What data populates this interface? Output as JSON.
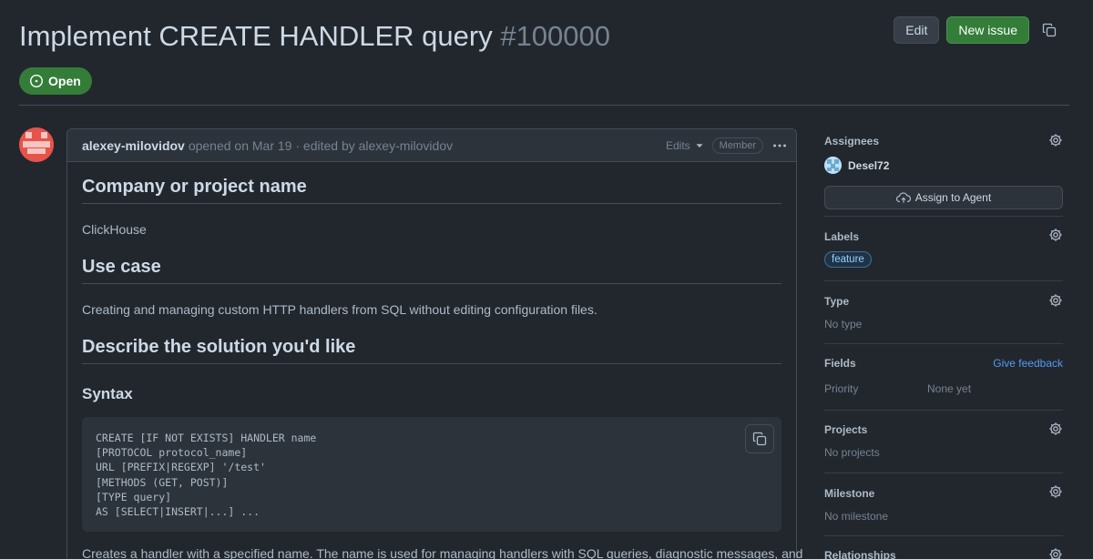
{
  "issue": {
    "title": "Implement CREATE HANDLER query",
    "number": "#100000",
    "state": "Open"
  },
  "header_actions": {
    "edit_label": "Edit",
    "new_issue_label": "New issue"
  },
  "comment": {
    "author": "alexey-milovidov",
    "meta": "opened on Mar 19 · edited by alexey-milovidov",
    "edits_label": "Edits",
    "role_badge": "Member",
    "sections": {
      "h_company": "Company or project name",
      "company": "ClickHouse",
      "h_usecase": "Use case",
      "usecase": "Creating and managing custom HTTP handlers from SQL without editing configuration files.",
      "h_solution": "Describe the solution you'd like",
      "h_syntax": "Syntax",
      "tail": "Creates a handler with a specified name. The name is used for managing handlers with SQL queries, diagnostic messages, and"
    },
    "code_lines": [
      "CREATE [IF NOT EXISTS] HANDLER name",
      "[PROTOCOL protocol_name]",
      "URL [PREFIX|REGEXP] '/test'",
      "[METHODS (GET, POST)]",
      "[TYPE query]",
      "AS [SELECT|INSERT|...] ..."
    ]
  },
  "sidebar": {
    "assignees": {
      "title": "Assignees",
      "user": "Desel72",
      "agent_button": "Assign to Agent"
    },
    "labels": {
      "title": "Labels",
      "items": [
        "feature"
      ]
    },
    "type": {
      "title": "Type",
      "value": "No type"
    },
    "fields": {
      "title": "Fields",
      "feedback": "Give feedback",
      "priority_name": "Priority",
      "priority_value": "None yet"
    },
    "projects": {
      "title": "Projects",
      "value": "No projects"
    },
    "milestone": {
      "title": "Milestone",
      "value": "No milestone"
    },
    "relationships": {
      "title": "Relationships"
    }
  },
  "colors": {
    "background": "#22272e",
    "open_green": "#347d39",
    "link_blue": "#539bf5",
    "avatar_red": "#e5534b"
  },
  "icons": [
    "issue-opened-icon",
    "copy-icon",
    "triangle-down-icon",
    "kebab-horizontal-icon",
    "gear-icon",
    "cloud-agent-icon"
  ]
}
